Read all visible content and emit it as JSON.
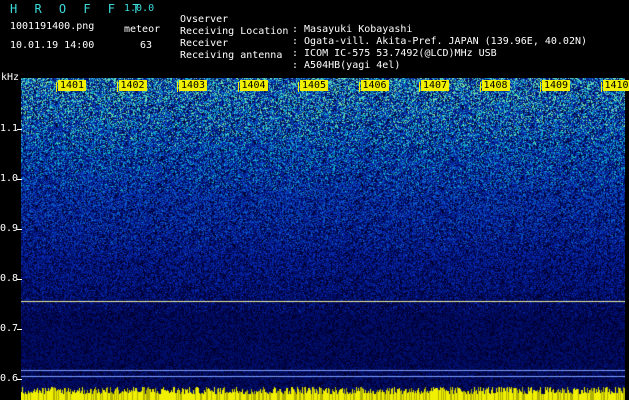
{
  "app": {
    "name": "H R O F F T",
    "version": "1.0.0"
  },
  "file_name": "1001191400.png",
  "timestamp": "10.01.19 14:00",
  "meteor": {
    "label": "meteor",
    "count": "63"
  },
  "info": [
    {
      "key": "Ovserver",
      "value": ": Masayuki Kobayashi"
    },
    {
      "key": "Receiving Location",
      "value": ": Ogata-vill. Akita-Pref. JAPAN (139.96E, 40.02N)"
    },
    {
      "key": "Receiver",
      "value": ": ICOM IC-575 53.7492(@LCD)MHz USB"
    },
    {
      "key": "Receiving antenna",
      "value": ": A504HB(yagi 4el)"
    }
  ],
  "y_axis": {
    "unit": "kHz",
    "ticks": [
      "1.1",
      "1.0",
      "0.9",
      "0.8",
      "0.7",
      "0.6"
    ]
  },
  "time_ticks": [
    "1401",
    "1402",
    "1403",
    "1404",
    "1405",
    "1406",
    "1407",
    "1408",
    "1409",
    "1410"
  ],
  "colors": {
    "accent": "#3cdcdc",
    "tick_highlight": "#f0f000",
    "line": "#f0f0a0"
  }
}
